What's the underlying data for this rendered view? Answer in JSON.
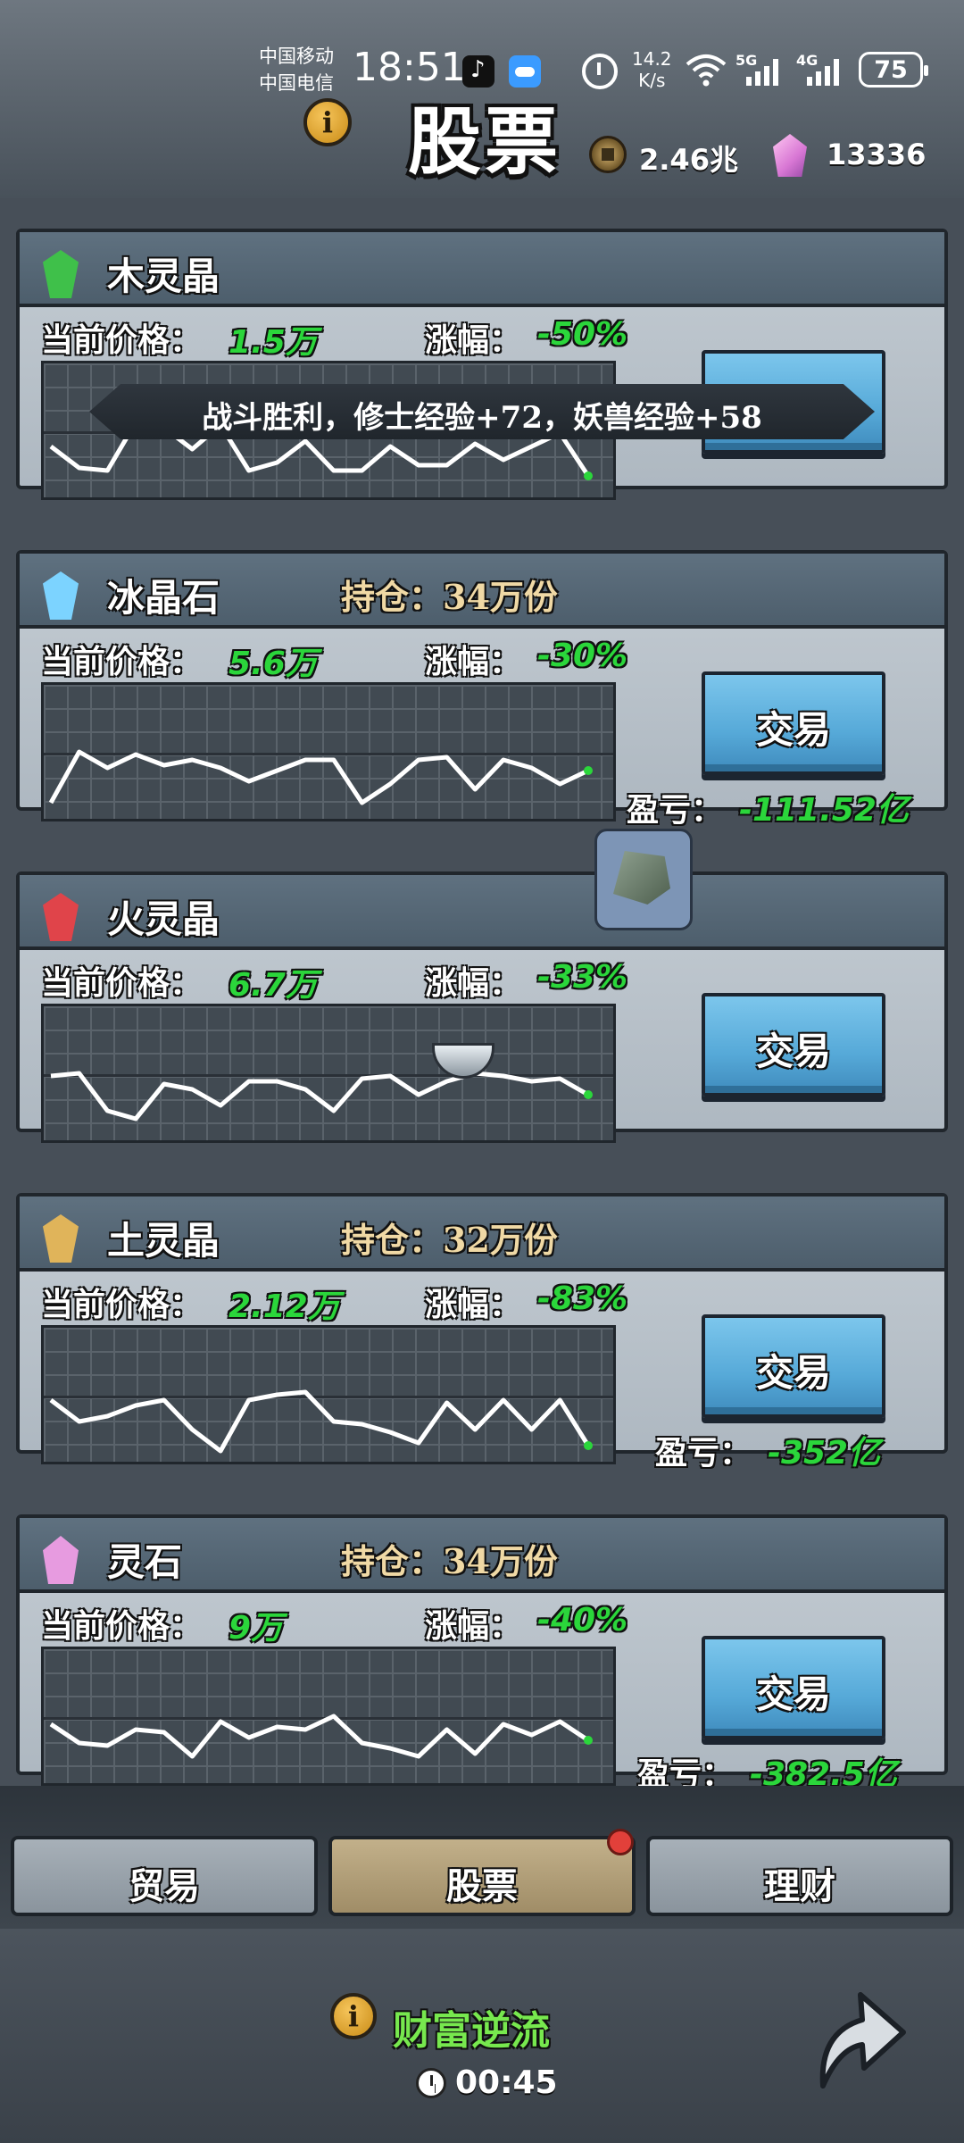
{
  "status_bar": {
    "carrier1": "中国移动",
    "carrier2": "中国电信",
    "time": "18:51",
    "net_speed_value": "14.2",
    "net_speed_unit": "K/s",
    "sim1_type": "5G",
    "sim2_type": "4G",
    "battery": "75"
  },
  "header": {
    "title": "股票",
    "copper_coins": "2.46兆",
    "spirit_gems": "13336"
  },
  "toast": "战斗胜利，修士经验+72，妖兽经验+58",
  "labels": {
    "price": "当前价格：",
    "change": "涨幅：",
    "holding_prefix": "持仓：",
    "pnl": "盈亏：",
    "trade": "交易"
  },
  "stocks": [
    {
      "name": "木灵晶",
      "holding": "",
      "price": "1.5万",
      "change": "-50%",
      "pnl": "",
      "crystal_color": "#3fc04a",
      "chart": [
        0.62,
        0.78,
        0.8,
        0.44,
        0.48,
        0.64,
        0.46,
        0.8,
        0.74,
        0.58,
        0.8,
        0.8,
        0.62,
        0.76,
        0.76,
        0.6,
        0.72,
        0.62,
        0.52,
        0.84
      ]
    },
    {
      "name": "冰晶石",
      "holding": "34万份",
      "price": "5.6万",
      "change": "-30%",
      "pnl": "-111.52亿",
      "crystal_color": "#7cd3ff",
      "chart": [
        0.88,
        0.5,
        0.62,
        0.52,
        0.6,
        0.56,
        0.62,
        0.72,
        0.64,
        0.56,
        0.56,
        0.88,
        0.74,
        0.56,
        0.54,
        0.78,
        0.56,
        0.62,
        0.74,
        0.64
      ]
    },
    {
      "name": "火灵晶",
      "holding": "",
      "price": "6.7万",
      "change": "-33%",
      "pnl": "",
      "crystal_color": "#e0444a",
      "chart": [
        0.52,
        0.5,
        0.78,
        0.84,
        0.58,
        0.62,
        0.74,
        0.56,
        0.56,
        0.62,
        0.78,
        0.54,
        0.52,
        0.66,
        0.56,
        0.5,
        0.52,
        0.56,
        0.54,
        0.66
      ]
    },
    {
      "name": "土灵晶",
      "holding": "32万份",
      "price": "2.12万",
      "change": "-83%",
      "pnl": "-352亿",
      "crystal_color": "#e0b45a",
      "chart": [
        0.54,
        0.7,
        0.66,
        0.58,
        0.54,
        0.76,
        0.92,
        0.54,
        0.5,
        0.48,
        0.7,
        0.72,
        0.78,
        0.86,
        0.56,
        0.76,
        0.54,
        0.76,
        0.54,
        0.88
      ]
    },
    {
      "name": "灵石",
      "holding": "34万份",
      "price": "9万",
      "change": "-40%",
      "pnl": "-382.5亿",
      "crystal_color": "#e79be0",
      "chart": [
        0.56,
        0.7,
        0.72,
        0.6,
        0.62,
        0.8,
        0.54,
        0.66,
        0.58,
        0.6,
        0.5,
        0.7,
        0.74,
        0.8,
        0.6,
        0.78,
        0.56,
        0.64,
        0.54,
        0.68
      ]
    }
  ],
  "tabs": [
    {
      "label": "贸易",
      "active": false
    },
    {
      "label": "股票",
      "active": true
    },
    {
      "label": "理财",
      "active": false
    }
  ],
  "footer": {
    "event_title": "财富逆流",
    "countdown": "00:45"
  }
}
